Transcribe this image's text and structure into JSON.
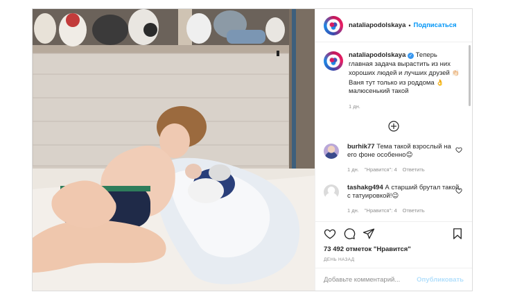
{
  "post": {
    "username": "nataliapodolskaya",
    "dot": "•",
    "follow_label": "Подписаться",
    "caption": {
      "username": "nataliapodolskaya",
      "verified_mark": "✓",
      "text_1": " Теперь главная задача вырастить из них хороших людей и лучших друзей ",
      "emoji_1": "👏🏻",
      "text_2": "Ваня тут только из роддома ",
      "emoji_2": "👌",
      "text_3": " малюсенький такой",
      "time": "1 дн."
    },
    "comments": [
      {
        "username": "burhik77",
        "text": " Тема такой взрослый на его фоне особенно",
        "emoji": "😊",
        "time": "1 дн.",
        "likes": "\"Нравится\": 4",
        "reply": "Ответить",
        "avatar_color": "#6a4fa3"
      },
      {
        "username": "tashakg494",
        "text": " А старший брутал такой, с татуировкой!",
        "emoji": "😉",
        "time": "1 дн.",
        "likes": "\"Нравится\": 4",
        "reply": "Ответить",
        "avatar_color": "#dbdbdb"
      }
    ],
    "likes_count": "73 492 отметок \"Нравится\"",
    "posted_ago": "ДЕНЬ НАЗАД",
    "comment_placeholder": "Добавьте комментарий...",
    "publish_label": "Опубликовать"
  },
  "colors": {
    "link_blue": "#0095f6",
    "publish_disabled": "#b2dffc",
    "meta_gray": "#8e8e8e",
    "border": "#dbdbdb"
  },
  "icons": [
    "heart-icon",
    "comment-icon",
    "share-icon",
    "bookmark-icon",
    "plus-circle-icon",
    "verified-badge-icon"
  ]
}
